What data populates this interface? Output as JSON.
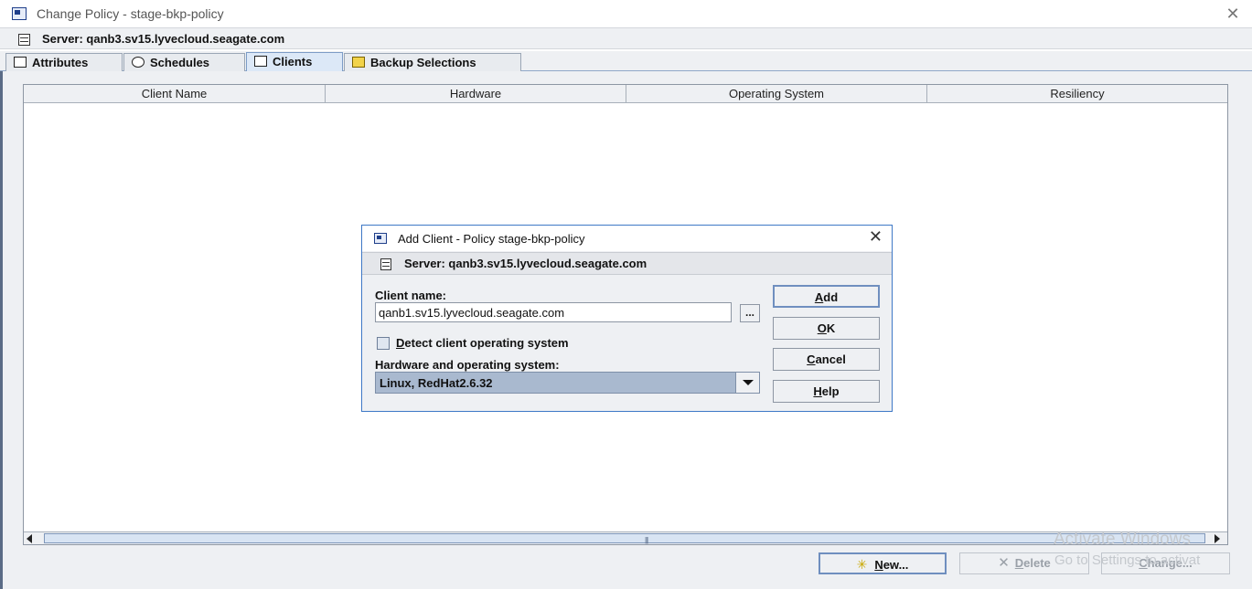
{
  "window": {
    "title": "Change Policy - stage-bkp-policy",
    "close_glyph": "✕"
  },
  "server_bar": {
    "text": "Server: qanb3.sv15.lyvecloud.seagate.com"
  },
  "tabs": [
    {
      "label": "Attributes",
      "icon": "attributes-icon",
      "active": false
    },
    {
      "label": "Schedules",
      "icon": "schedules-icon",
      "active": false
    },
    {
      "label": "Clients",
      "icon": "clients-icon",
      "active": true
    },
    {
      "label": "Backup Selections",
      "icon": "backup-selections-icon",
      "active": false
    }
  ],
  "clients_table": {
    "columns": [
      "Client Name",
      "Hardware",
      "Operating System",
      "Resiliency"
    ],
    "rows": []
  },
  "bottom_buttons": {
    "new": {
      "label_u": "N",
      "label_rest": "ew...",
      "enabled": true
    },
    "delete": {
      "label_u": "D",
      "label_rest": "elete",
      "enabled": false
    },
    "change": {
      "label_u": "C",
      "label_rest": "hange...",
      "enabled": false
    }
  },
  "watermark": {
    "line1": "Activate Windows",
    "line2": "Go to Settings to activat"
  },
  "add_client_dialog": {
    "title": "Add Client - Policy stage-bkp-policy",
    "server_text": "Server: qanb3.sv15.lyvecloud.seagate.com",
    "client_name_label": "Client name:",
    "client_name_value": "qanb1.sv15.lyvecloud.seagate.com",
    "browse_label": "...",
    "detect_label_u": "D",
    "detect_label_rest": "etect client operating system",
    "detect_checked": false,
    "hw_os_label": "Hardware and operating system:",
    "hw_os_value": "Linux, RedHat2.6.32",
    "buttons": {
      "add": {
        "u": "A",
        "rest": "dd"
      },
      "ok": {
        "u": "O",
        "rest": "K"
      },
      "cancel": {
        "u": "C",
        "rest": "ancel"
      },
      "help": {
        "u": "H",
        "rest": "elp"
      }
    }
  },
  "colors": {
    "accent": "#3e78c6",
    "selection": "#a9b9cf",
    "panel": "#eef0f3"
  }
}
